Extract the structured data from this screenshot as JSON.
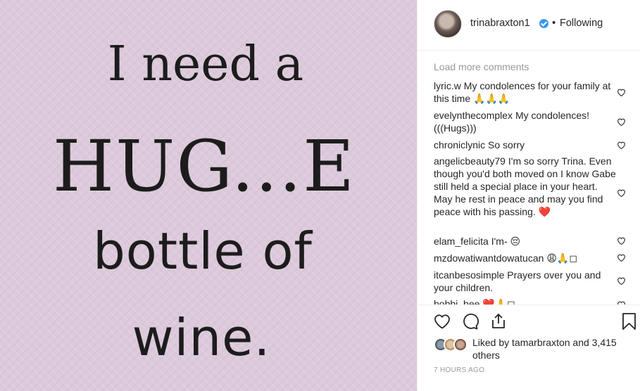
{
  "image": {
    "lines": [
      "I need a",
      "HUG...E",
      "bottle of",
      "wine."
    ]
  },
  "header": {
    "username": "trinabraxton1",
    "verified_icon": "verified-badge-icon",
    "separator": "•",
    "follow_status": "Following"
  },
  "comments": {
    "load_more": "Load more comments",
    "items": [
      {
        "user": "lyric.w",
        "text": "My condolences for your family at this time 🙏🙏🙏"
      },
      {
        "user": "evelynthecomplex",
        "text": "My condolences! (((Hugs)))"
      },
      {
        "user": "chroniclynic",
        "text": "So sorry"
      },
      {
        "user": "angelicbeauty79",
        "text": "I'm so sorry Trina. Even though you'd both moved on I know Gabe still held a special place in your heart. May he rest in peace and may you find peace with his passing. ❤️"
      },
      {
        "user": "elam_felicita",
        "text": "I'm- 😔"
      },
      {
        "user": "mzdowatiwantdowatucan",
        "text": "😩🙏◻"
      },
      {
        "user": "itcanbesosimple",
        "text": "Prayers over you and your children."
      },
      {
        "user": "bobbi_bee",
        "text": "❤️🙏◻"
      }
    ]
  },
  "actions": {
    "like_icon": "heart-icon",
    "comment_icon": "comment-icon",
    "share_icon": "share-icon",
    "save_icon": "bookmark-icon"
  },
  "likes": {
    "prefix": "Liked by",
    "user": "tamarbraxton",
    "suffix": "and 3,415 others"
  },
  "timestamp": "7 HOURS AGO"
}
